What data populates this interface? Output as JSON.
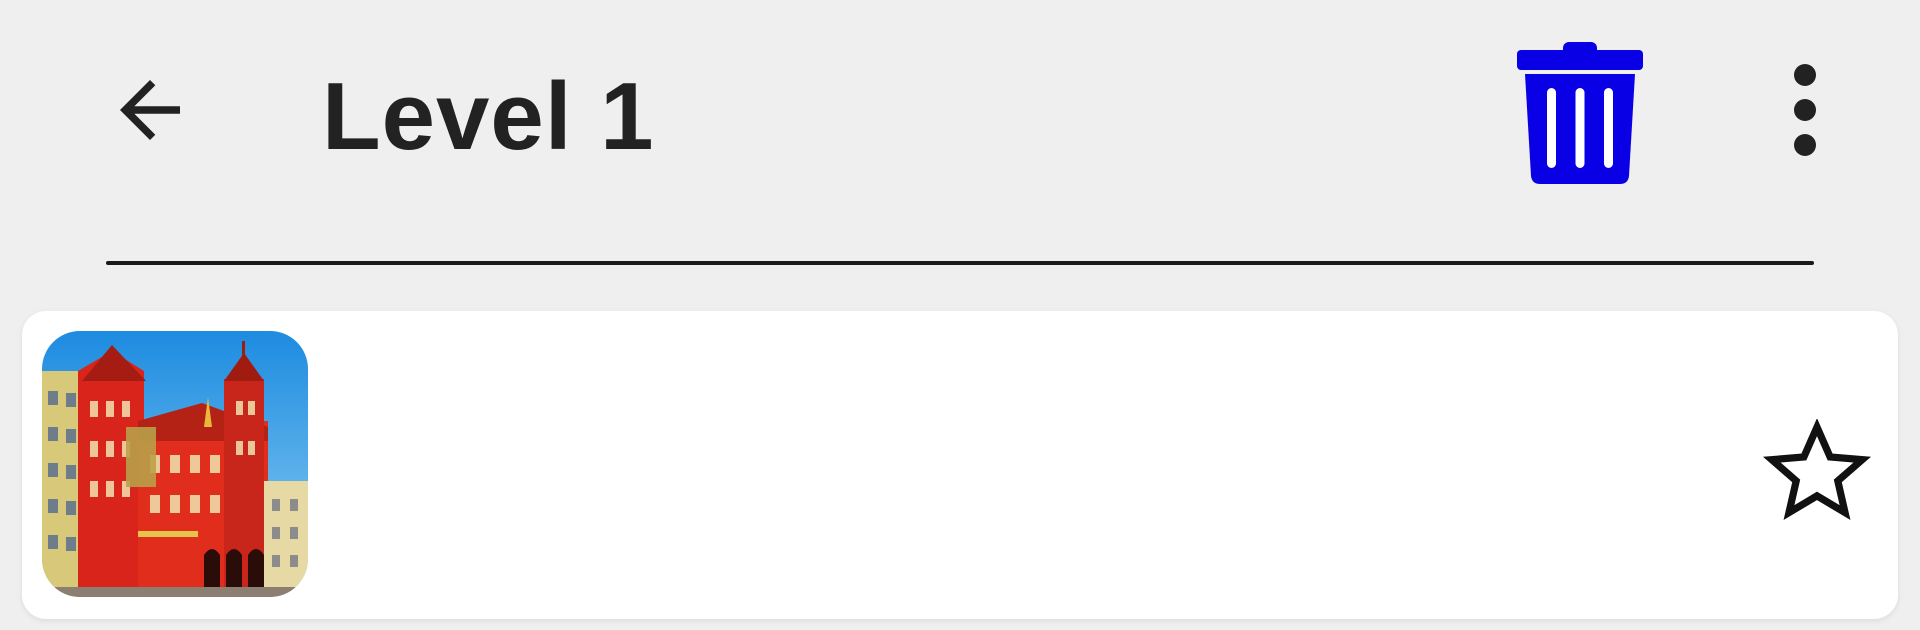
{
  "app_bar": {
    "title": "Level 1",
    "back_icon": "arrow-left-icon",
    "delete_icon": "trash-icon",
    "menu_icon": "more-vert-icon",
    "delete_color": "#0a00e6"
  },
  "list": {
    "items": [
      {
        "thumbnail_icon": "red-town-hall-image",
        "favorite_icon": "star-outline-icon",
        "favorited": false
      }
    ]
  }
}
